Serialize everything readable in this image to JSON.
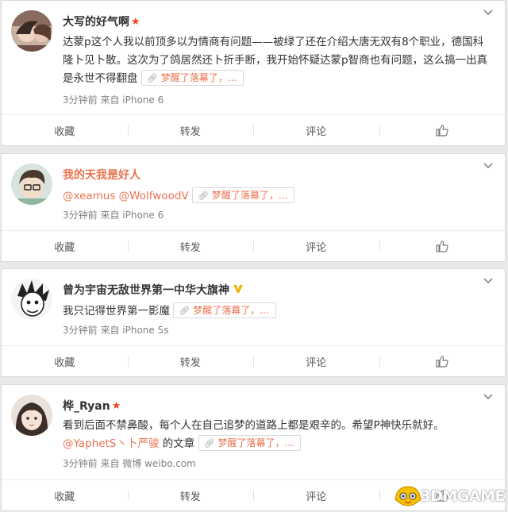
{
  "posts": [
    {
      "name": "大写的好气啊",
      "text": "达蒙p这个人我以前顶多以为情商有问题——被绿了还在介绍大唐无双有8个职业，德国科隆卜见卜散。这次为了鸽居然还卜折手断，我开始怀疑达蒙p智商也有问题，这么搞一出真是永世不得翻盘",
      "link": "梦醒了落幕了，...",
      "time": "3分钟前",
      "source": "来自 iPhone 6"
    },
    {
      "name": "我的天我是好人",
      "mention": "@xeamus @WolfwoodV",
      "link": "梦醒了落幕了，...",
      "time": "3分钟前",
      "source": "来自 iPhone 6"
    },
    {
      "name": "曾为宇宙无敌世界第一中华大旗神",
      "text": "我只记得世界第一影魔",
      "link": "梦醒了落幕了，...",
      "time": "3分钟前",
      "source": "来自 iPhone 5s"
    },
    {
      "name": "桦_Ryan",
      "text": "看到后面不禁鼻酸，每个人在自己追梦的道路上都是艰辛的。希望P神快乐就好。",
      "mention": "@YaphetS丶卜严骏",
      "mention_suffix": " 的文章",
      "link": "梦醒了落幕了，...",
      "time": "3分钟前",
      "source": "来自 微博 weibo.com"
    }
  ],
  "actions": {
    "collect": "收藏",
    "forward": "转发",
    "comment": "评论"
  },
  "icons": {
    "menu": "chevron-down-icon",
    "like": "thumbs-up-icon",
    "link": "link-icon",
    "verified": "verified-v-icon"
  },
  "colors": {
    "accent": "#eb7350",
    "red_badge": "#f4411c",
    "verified": "#f5b000"
  },
  "watermark": "3DMGAME"
}
